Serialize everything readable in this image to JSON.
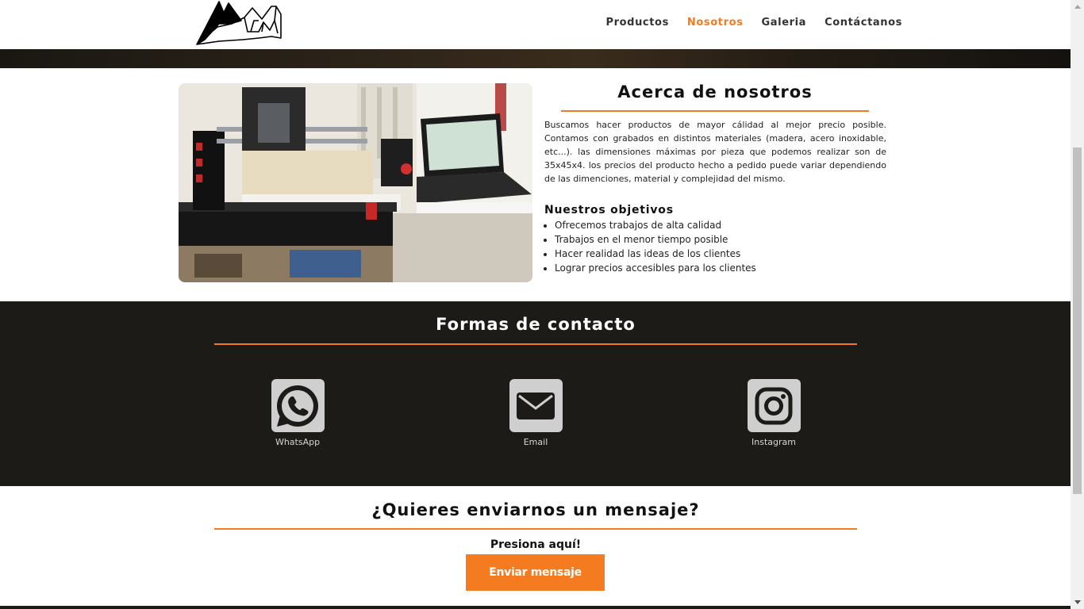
{
  "nav": {
    "items": [
      {
        "label": "Productos",
        "active": false
      },
      {
        "label": "Nosotros",
        "active": true
      },
      {
        "label": "Galeria",
        "active": false
      },
      {
        "label": "Contáctanos",
        "active": false
      }
    ]
  },
  "about": {
    "title": "Acerca de nosotros",
    "text": "Buscamos hacer productos de mayor cálidad al mejor precio posible. Contamos con grabados en distintos materiales (madera, acero inoxidable, etc...). las dimensiones máximas por pieza que podemos realizar son de 35x45x4. los precios del producto hecho a pedido puede variar dependiendo de las dimenciones, material y complejidad del mismo.",
    "objectives_title": "Nuestros objetivos",
    "objectives": [
      "Ofrecemos trabajos de alta calidad",
      "Trabajos en el menor tiempo posible",
      "Hacer realidad las ideas de los clientes",
      "Lograr precios accesibles para los clientes"
    ]
  },
  "contact": {
    "title": "Formas de contacto",
    "items": [
      {
        "label": "WhatsApp",
        "icon": "whatsapp-icon"
      },
      {
        "label": "Email",
        "icon": "email-icon"
      },
      {
        "label": "Instagram",
        "icon": "instagram-icon"
      }
    ]
  },
  "message": {
    "title": "¿Quieres enviarnos un mensaje?",
    "hint": "Presiona aquí!",
    "button_label": "Enviar mensaje"
  },
  "colors": {
    "accent": "#f47b20",
    "dark_section": "#1c1b17",
    "icon_tile": "#cfcfcf"
  }
}
